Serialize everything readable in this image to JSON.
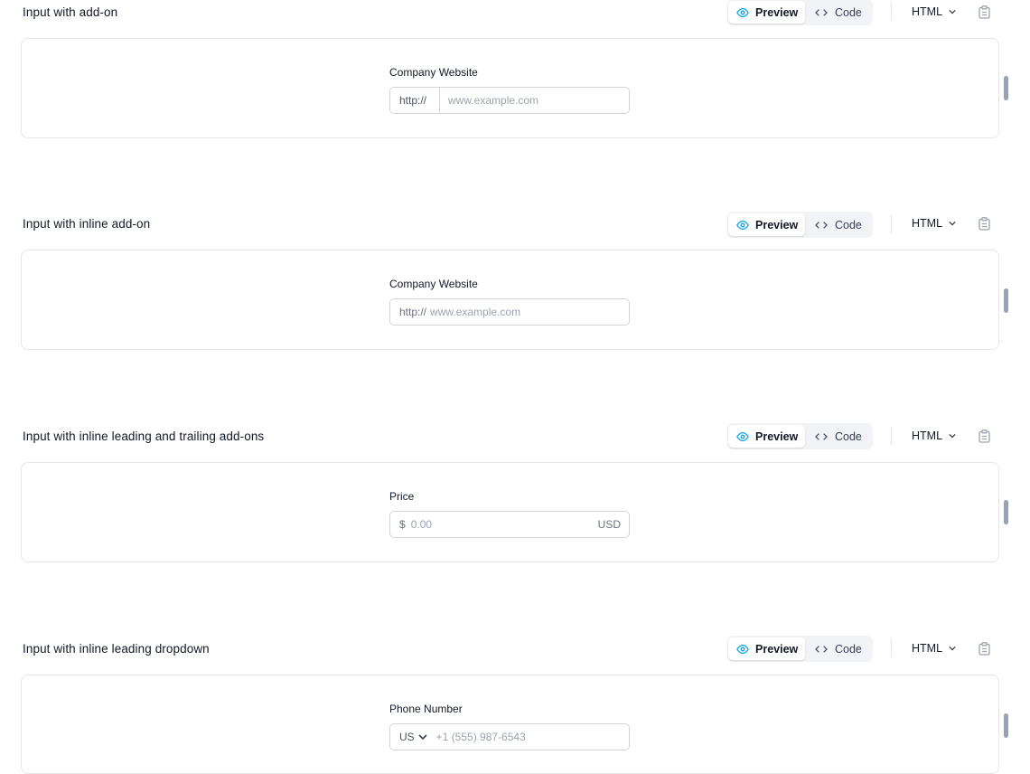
{
  "toolbar": {
    "preview_label": "Preview",
    "code_label": "Code",
    "language_label": "HTML"
  },
  "sections": [
    {
      "title": "Input with add-on",
      "field_label": "Company Website",
      "addon": "http://",
      "placeholder": "www.example.com"
    },
    {
      "title": "Input with inline add-on",
      "field_label": "Company Website",
      "prefix": "http://",
      "placeholder": "www.example.com"
    },
    {
      "title": "Input with inline leading and trailing add-ons",
      "field_label": "Price",
      "prefix": "$",
      "placeholder": "0.00",
      "suffix": "USD"
    },
    {
      "title": "Input with inline leading dropdown",
      "field_label": "Phone Number",
      "dropdown_value": "US",
      "placeholder": "+1 (555) 987-6543"
    }
  ],
  "colors": {
    "accent": "#0ea5e9",
    "border": "#e5e7eb",
    "input_border": "#d1d5db",
    "placeholder": "#9ca3af",
    "scroll_marker": "#94a3b8"
  },
  "icons": {
    "preview": "eye-icon",
    "code": "code-brackets-icon",
    "language": "chevron-down-icon",
    "copy": "clipboard-icon"
  }
}
